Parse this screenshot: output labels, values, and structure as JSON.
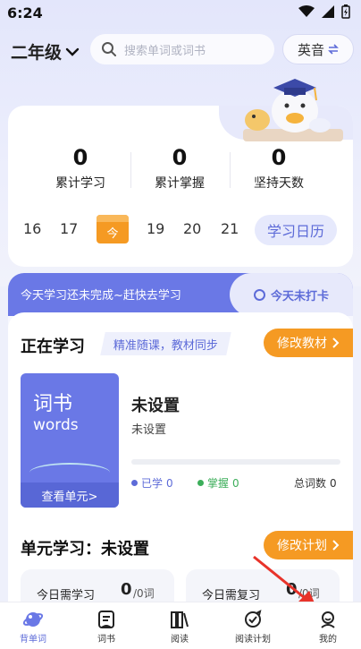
{
  "status_bar": {
    "time": "6:24"
  },
  "header": {
    "grade": "二年级",
    "search_placeholder": "搜索单词或词书",
    "accent": "英音"
  },
  "stats": [
    {
      "value": "0",
      "label": "累计学习"
    },
    {
      "value": "0",
      "label": "累计掌握"
    },
    {
      "value": "0",
      "label": "坚持天数"
    }
  ],
  "week": {
    "days_before": [
      "16",
      "17"
    ],
    "today_label": "今",
    "days_after": [
      "19",
      "20",
      "21"
    ],
    "calendar_button": "学习日历"
  },
  "banner": {
    "message": "今天学习还未完成~赶快去学习",
    "checkin": "今天未打卡"
  },
  "learning": {
    "title": "正在学习",
    "tag": "精准随课，教材同步",
    "change_button": "修改教材",
    "book": {
      "cover_cn": "词书",
      "cover_en": "words",
      "view_units": "查看单元>",
      "title": "未设置",
      "subtitle": "未设置"
    },
    "legend": {
      "learned_label": "已学",
      "learned_value": "0",
      "mastered_label": "掌握",
      "mastered_value": "0",
      "total_label": "总词数",
      "total_value": "0"
    },
    "progress": 0
  },
  "unit": {
    "title": "单元学习：未设置",
    "plan_button": "修改计划",
    "today_learn_label": "今日需学习",
    "today_learn_value": "0",
    "today_learn_unit": "/0词",
    "today_review_label": "今日需复习",
    "today_review_value": "0",
    "today_review_unit": "/0词"
  },
  "nav": [
    {
      "label": "背单词",
      "icon": "planet-icon",
      "active": true
    },
    {
      "label": "词书",
      "icon": "book-icon",
      "active": false
    },
    {
      "label": "阅读",
      "icon": "books-icon",
      "active": false
    },
    {
      "label": "阅读计划",
      "icon": "target-icon",
      "active": false
    },
    {
      "label": "我的",
      "icon": "profile-icon",
      "active": false
    }
  ],
  "colors": {
    "primary": "#6a78e6",
    "orange": "#f59a23",
    "learned": "#5d6bd8",
    "mastered": "#3cae5a"
  }
}
